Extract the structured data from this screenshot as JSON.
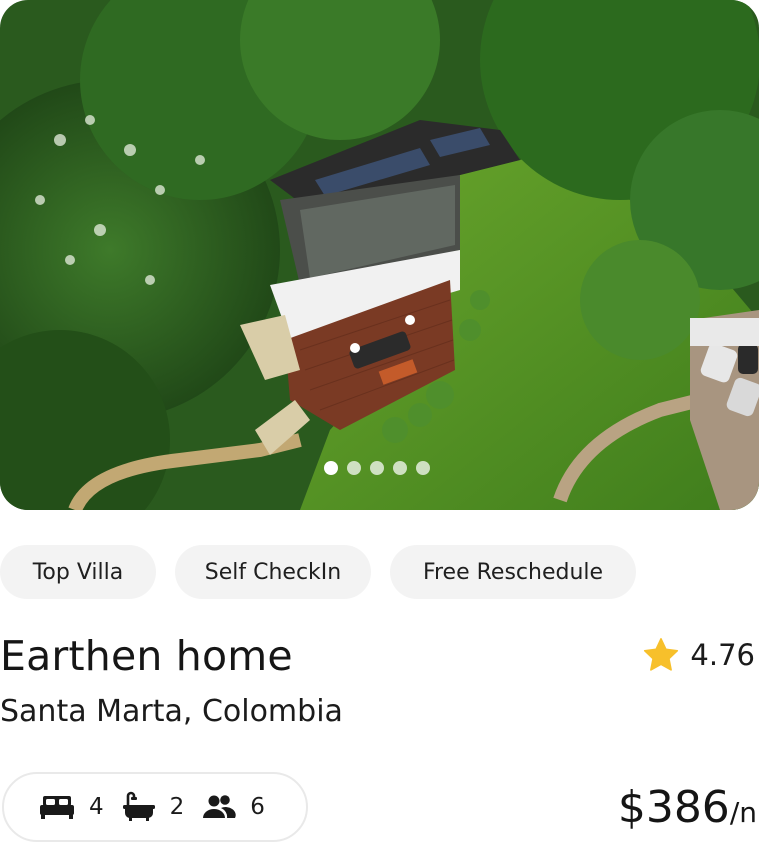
{
  "listing": {
    "image": {
      "alt": "",
      "carousel": {
        "count": 5,
        "active_index": 0
      }
    },
    "tags": [
      "Top Villa",
      "Self CheckIn",
      "Free Reschedule"
    ],
    "title": "Earthen home",
    "location": "Santa Marta, Colombia",
    "rating": {
      "value": "4.76",
      "icon": "star-icon",
      "color": "#F7C02B"
    },
    "amenities": [
      {
        "icon": "bed-icon",
        "count": "4"
      },
      {
        "icon": "bathtub-icon",
        "count": "2"
      },
      {
        "icon": "guests-icon",
        "count": "6"
      }
    ],
    "price": {
      "amount": "$386",
      "period": "/n"
    }
  }
}
